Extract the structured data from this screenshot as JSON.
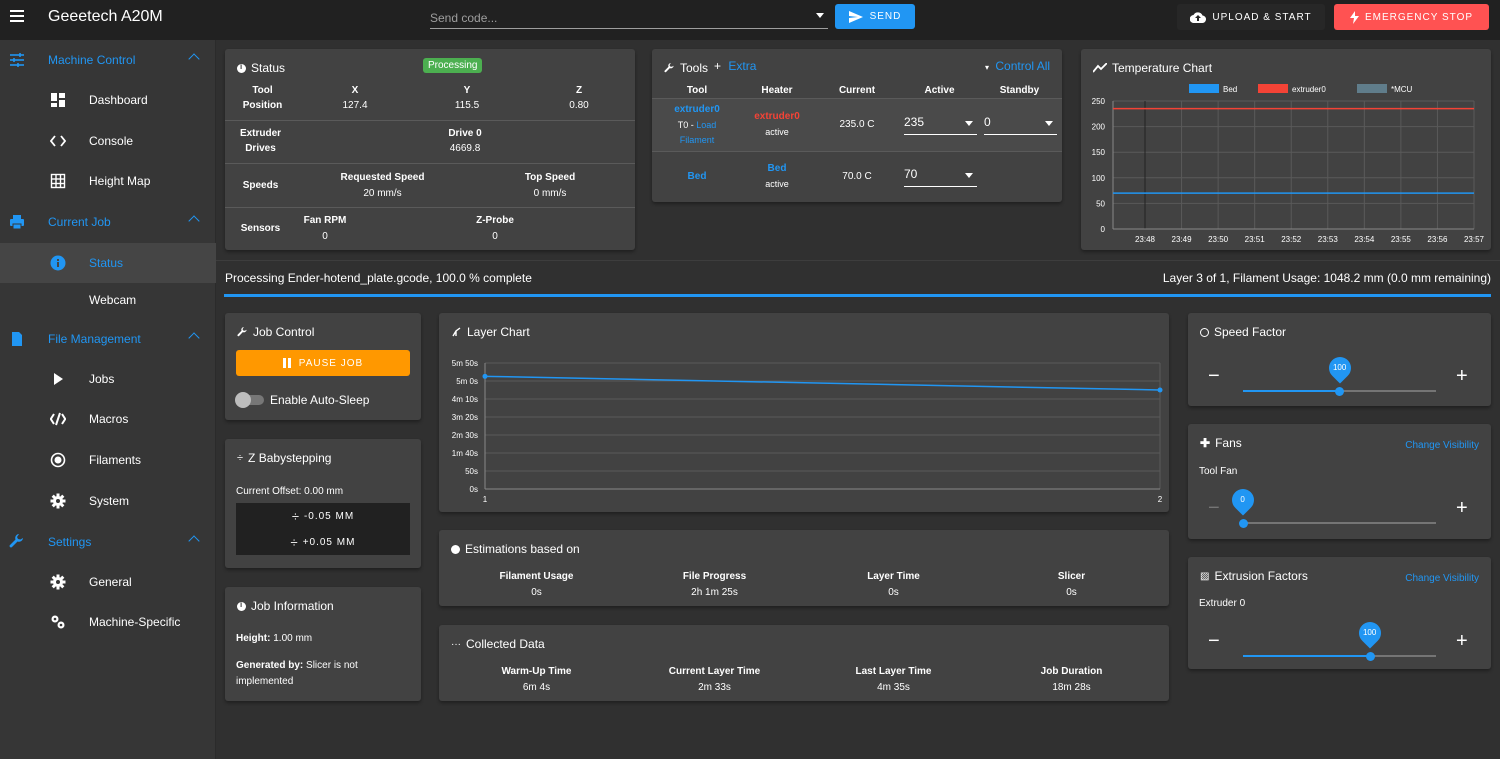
{
  "app": {
    "title": "Geeetech A20M"
  },
  "toolbar": {
    "send_placeholder": "Send code...",
    "send_label": "SEND",
    "upload_label": "UPLOAD & START",
    "estop_label": "EMERGENCY STOP"
  },
  "sidebar": {
    "machine_control": "Machine Control",
    "dashboard": "Dashboard",
    "console": "Console",
    "height_map": "Height Map",
    "current_job": "Current Job",
    "status": "Status",
    "webcam": "Webcam",
    "file_management": "File Management",
    "jobs": "Jobs",
    "macros": "Macros",
    "filaments": "Filaments",
    "system": "System",
    "settings": "Settings",
    "general": "General",
    "machine_specific": "Machine-Specific"
  },
  "status_card": {
    "title": "Status",
    "badge": "Processing",
    "tool_label": "Tool",
    "position_label": "Position",
    "x_label": "X",
    "x_value": "127.4",
    "y_label": "Y",
    "y_value": "115.5",
    "z_label": "Z",
    "z_value": "0.80",
    "extruder_label": "Extruder",
    "drives_label": "Drives",
    "drive0_label": "Drive 0",
    "drive0_value": "4669.8",
    "speeds_label": "Speeds",
    "req_speed_label": "Requested Speed",
    "req_speed_value": "20 mm/s",
    "top_speed_label": "Top Speed",
    "top_speed_value": "0 mm/s",
    "sensors_label": "Sensors",
    "fan_rpm_label": "Fan RPM",
    "fan_rpm_value": "0",
    "zprobe_label": "Z-Probe",
    "zprobe_value": "0"
  },
  "tools_card": {
    "title": "Tools",
    "extra_label": "Extra",
    "control_all_label": "Control All",
    "headers": [
      "Tool",
      "Heater",
      "Current",
      "Active",
      "Standby"
    ],
    "extruder_name": "extruder0",
    "extruder_sub": "T0 -",
    "load_label": "Load",
    "filament_label": "Filament",
    "extruder_heater": "extruder0",
    "extruder_heater_state": "active",
    "extruder_current": "235.0 C",
    "extruder_active": "235",
    "extruder_standby": "0",
    "bed_name": "Bed",
    "bed_heater": "Bed",
    "bed_heater_state": "active",
    "bed_current": "70.0 C",
    "bed_active": "70"
  },
  "temp_chart": {
    "title": "Temperature Chart",
    "chart_data": {
      "type": "line",
      "title": "Temperature Chart",
      "x": [
        "23:48",
        "23:49",
        "23:50",
        "23:51",
        "23:52",
        "23:53",
        "23:54",
        "23:55",
        "23:56",
        "23:57"
      ],
      "yticks": [
        0,
        50,
        100,
        150,
        200,
        250
      ],
      "ylim": [
        0,
        250
      ],
      "legend": "top",
      "grid": true,
      "series": [
        {
          "name": "Bed",
          "color": "#2196f3",
          "values": [
            70,
            70,
            70,
            70,
            70,
            70,
            70,
            70,
            70,
            70
          ]
        },
        {
          "name": "extruder0",
          "color": "#f44336",
          "values": [
            235,
            235,
            235,
            235,
            235,
            235,
            235,
            235,
            235,
            235
          ]
        },
        {
          "name": "*MCU",
          "color": "#607d8b",
          "values": []
        }
      ]
    }
  },
  "job_progress": {
    "left_text": "Processing Ender-hotend_plate.gcode, 100.0 % complete",
    "right_text": "Layer 3 of 1, Filament Usage: 1048.2 mm (0.0 mm remaining)",
    "progress": 1.0
  },
  "job_control": {
    "title": "Job Control",
    "pause_label": "PAUSE JOB",
    "auto_sleep_label": "Enable Auto-Sleep"
  },
  "babystep": {
    "title": "Z Babystepping",
    "offset_text": "Current Offset: 0.00 mm",
    "minus_label": "-0.05 MM",
    "plus_label": "+0.05 MM"
  },
  "job_info": {
    "title": "Job Information",
    "height_label": "Height:",
    "height_value": "1.00 mm",
    "generated_label": "Generated by:",
    "generated_value_1": "Slicer is not",
    "generated_value_2": "implemented"
  },
  "layer_chart": {
    "title": "Layer Chart",
    "chart_data": {
      "type": "line",
      "title": "Layer Chart",
      "x": [
        1,
        2
      ],
      "xticks": [
        "1",
        "2"
      ],
      "yticks": [
        "0s",
        "50s",
        "1m 40s",
        "2m 30s",
        "3m 20s",
        "4m 10s",
        "5m 0s",
        "5m 50s"
      ],
      "ylim": [
        0,
        350
      ],
      "grid": true,
      "series": [
        {
          "color": "#2196f3",
          "values": [
            313,
            275
          ]
        }
      ]
    }
  },
  "estimations": {
    "title": "Estimations based on",
    "labels": [
      "Filament Usage",
      "File Progress",
      "Layer Time",
      "Slicer"
    ],
    "values": [
      "0s",
      "2h 1m 25s",
      "0s",
      "0s"
    ]
  },
  "collected": {
    "title": "Collected Data",
    "labels": [
      "Warm-Up Time",
      "Current Layer Time",
      "Last Layer Time",
      "Job Duration"
    ],
    "values": [
      "6m 4s",
      "2m 33s",
      "4m 35s",
      "18m 28s"
    ]
  },
  "speed_factor": {
    "title": "Speed Factor",
    "value": "100",
    "fraction": 0.5
  },
  "fans": {
    "title": "Fans",
    "visibility_label": "Change Visibility",
    "fan_label": "Tool Fan",
    "value": "0",
    "fraction": 0.0
  },
  "extrusion": {
    "title": "Extrusion Factors",
    "visibility_label": "Change Visibility",
    "extruder_label": "Extruder 0",
    "value": "100",
    "fraction": 0.66
  }
}
